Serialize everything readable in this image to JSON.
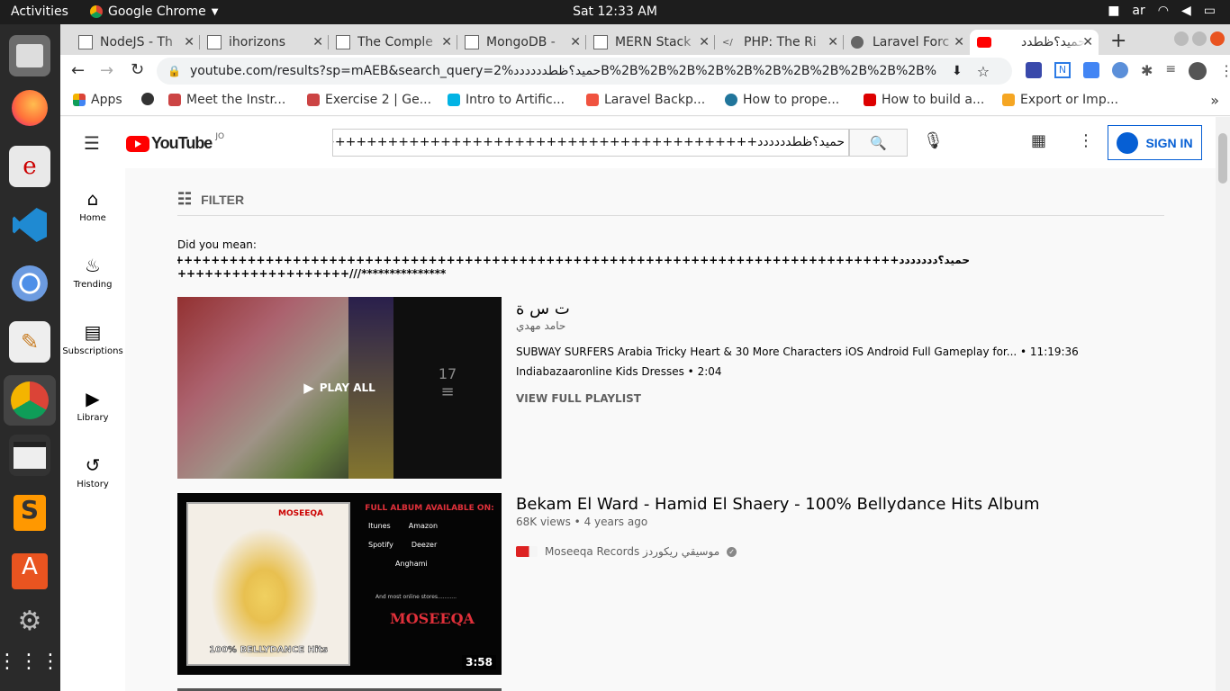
{
  "system": {
    "activities": "Activities",
    "app_name": "Google Chrome",
    "clock": "Sat 12:33 AM",
    "lang": "ar"
  },
  "tabs": [
    {
      "title": "NodeJS - Th"
    },
    {
      "title": "ihorizons"
    },
    {
      "title": "The Comple"
    },
    {
      "title": "MongoDB -"
    },
    {
      "title": "MERN Stack"
    },
    {
      "title": "PHP: The Ri"
    },
    {
      "title": "Laravel Forc"
    },
    {
      "title": "حميد؟ظطدد"
    }
  ],
  "address": {
    "url": "youtube.com/results?sp=mAEB&search_query=2%حميد؟ظطددددددB%2B%2B%2B%2B%2B%2B%2B%2B%2B%2B%2B%2B%2..."
  },
  "bookmarks": [
    {
      "label": "Apps"
    },
    {
      "label": ""
    },
    {
      "label": "Meet the Instr..."
    },
    {
      "label": "Exercise 2 | Ge..."
    },
    {
      "label": "Intro to Artific..."
    },
    {
      "label": "Laravel Backp..."
    },
    {
      "label": "How to prope..."
    },
    {
      "label": "How to build a..."
    },
    {
      "label": "Export or Imp..."
    }
  ],
  "yt": {
    "logo": "YouTube",
    "country": "JO",
    "search_value": "حميد؟ظطدددددد++++++++++++++++++++++++++++++++++++++++++++++++++",
    "sign_in": "SIGN IN",
    "filter": "FILTER",
    "did_you_mean": "Did you mean:",
    "suggestion_1": "حميد؟ددددددد+++++++++++++++++++++++++++++++++++++++++++++++++++++++++++++++++++++++++++++++++++++++++++-",
    "suggestion_2": "+++++++++++++++++++///***************",
    "sidebar": [
      {
        "label": "Home"
      },
      {
        "label": "Trending"
      },
      {
        "label": "Subscriptions"
      },
      {
        "label": "Library"
      },
      {
        "label": "History"
      }
    ],
    "results": [
      {
        "title": "ت س ة",
        "channel": "حامد مهدي",
        "play_all": "PLAY ALL",
        "count": "17",
        "line1": "SUBWAY SURFERS Arabia Tricky Heart & 30 More Characters iOS Android Full Gameplay for...",
        "line1_duration": "• 11:19:36",
        "line2": "Indiabazaaronline Kids Dresses",
        "line2_duration": "• 2:04",
        "view_full": "VIEW FULL PLAYLIST"
      },
      {
        "title": "Bekam El Ward - Hamid El Shaery - 100% Bellydance Hits Album",
        "views": "68K views",
        "age": "• 4 years ago",
        "channel": "Moseeqa Records موسيقي ريكوردز",
        "duration": "3:58",
        "thumb": {
          "head": "FULL ALBUM AVAILABLE ON:",
          "stores": [
            "Itunes",
            "Amazon",
            "Spotify",
            "Deezer",
            "Anghami"
          ],
          "more": "And most online stores...........",
          "brand": "MOSEEQA",
          "caption": "100% BELLYDANCE Hits",
          "mini_brand": "MOSEEQA"
        }
      }
    ]
  }
}
